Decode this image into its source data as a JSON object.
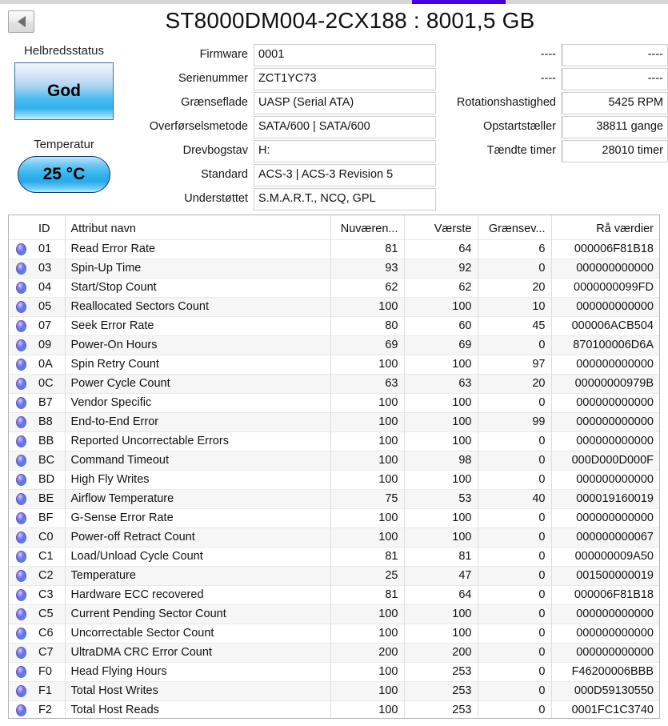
{
  "window": {
    "title": "ST8000DM004-2CX188 : 8001,5 GB",
    "back_button_label": "",
    "accent_color": "#4400e0"
  },
  "health": {
    "caption": "Helbredsstatus",
    "status": "God",
    "temp_caption": "Temperatur",
    "temperature": "25 °C"
  },
  "info_left": [
    {
      "label": "Firmware",
      "value": "0001"
    },
    {
      "label": "Serienummer",
      "value": "ZCT1YC73"
    },
    {
      "label": "Grænseflade",
      "value": "UASP (Serial ATA)"
    },
    {
      "label": "Overførselsmetode",
      "value": "SATA/600 | SATA/600"
    },
    {
      "label": "Drevbogstav",
      "value": "H:"
    },
    {
      "label": "Standard",
      "value": "ACS-3 | ACS-3 Revision 5"
    },
    {
      "label": "Understøttet",
      "value": "S.M.A.R.T., NCQ, GPL"
    }
  ],
  "info_right": [
    {
      "label": "----",
      "value": "----"
    },
    {
      "label": "----",
      "value": "----"
    },
    {
      "label": "Rotationshastighed",
      "value": "5425 RPM"
    },
    {
      "label": "Opstartstæller",
      "value": "38811 gange"
    },
    {
      "label": "Tændte timer",
      "value": "28010 timer"
    }
  ],
  "table": {
    "headers": {
      "icon": "",
      "id": "ID",
      "name": "Attribut navn",
      "current": "Nuværen...",
      "worst": "Værste",
      "threshold": "Grænsev...",
      "raw": "Rå værdier"
    },
    "rows": [
      {
        "icon": "status-dot-good",
        "id": "01",
        "name": "Read Error Rate",
        "current": "81",
        "worst": "64",
        "threshold": "6",
        "raw": "000006F81B18"
      },
      {
        "icon": "status-dot-good",
        "id": "03",
        "name": "Spin-Up Time",
        "current": "93",
        "worst": "92",
        "threshold": "0",
        "raw": "000000000000"
      },
      {
        "icon": "status-dot-good",
        "id": "04",
        "name": "Start/Stop Count",
        "current": "62",
        "worst": "62",
        "threshold": "20",
        "raw": "0000000099FD"
      },
      {
        "icon": "status-dot-good",
        "id": "05",
        "name": "Reallocated Sectors Count",
        "current": "100",
        "worst": "100",
        "threshold": "10",
        "raw": "000000000000"
      },
      {
        "icon": "status-dot-good",
        "id": "07",
        "name": "Seek Error Rate",
        "current": "80",
        "worst": "60",
        "threshold": "45",
        "raw": "000006ACB504"
      },
      {
        "icon": "status-dot-good",
        "id": "09",
        "name": "Power-On Hours",
        "current": "69",
        "worst": "69",
        "threshold": "0",
        "raw": "870100006D6A"
      },
      {
        "icon": "status-dot-good",
        "id": "0A",
        "name": "Spin Retry Count",
        "current": "100",
        "worst": "100",
        "threshold": "97",
        "raw": "000000000000"
      },
      {
        "icon": "status-dot-good",
        "id": "0C",
        "name": "Power Cycle Count",
        "current": "63",
        "worst": "63",
        "threshold": "20",
        "raw": "00000000979B"
      },
      {
        "icon": "status-dot-good",
        "id": "B7",
        "name": "Vendor Specific",
        "current": "100",
        "worst": "100",
        "threshold": "0",
        "raw": "000000000000"
      },
      {
        "icon": "status-dot-good",
        "id": "B8",
        "name": "End-to-End Error",
        "current": "100",
        "worst": "100",
        "threshold": "99",
        "raw": "000000000000"
      },
      {
        "icon": "status-dot-good",
        "id": "BB",
        "name": "Reported Uncorrectable Errors",
        "current": "100",
        "worst": "100",
        "threshold": "0",
        "raw": "000000000000"
      },
      {
        "icon": "status-dot-good",
        "id": "BC",
        "name": "Command Timeout",
        "current": "100",
        "worst": "98",
        "threshold": "0",
        "raw": "000D000D000F"
      },
      {
        "icon": "status-dot-good",
        "id": "BD",
        "name": "High Fly Writes",
        "current": "100",
        "worst": "100",
        "threshold": "0",
        "raw": "000000000000"
      },
      {
        "icon": "status-dot-good",
        "id": "BE",
        "name": "Airflow Temperature",
        "current": "75",
        "worst": "53",
        "threshold": "40",
        "raw": "000019160019"
      },
      {
        "icon": "status-dot-good",
        "id": "BF",
        "name": "G-Sense Error Rate",
        "current": "100",
        "worst": "100",
        "threshold": "0",
        "raw": "000000000000"
      },
      {
        "icon": "status-dot-good",
        "id": "C0",
        "name": "Power-off Retract Count",
        "current": "100",
        "worst": "100",
        "threshold": "0",
        "raw": "000000000067"
      },
      {
        "icon": "status-dot-good",
        "id": "C1",
        "name": "Load/Unload Cycle Count",
        "current": "81",
        "worst": "81",
        "threshold": "0",
        "raw": "000000009A50"
      },
      {
        "icon": "status-dot-good",
        "id": "C2",
        "name": "Temperature",
        "current": "25",
        "worst": "47",
        "threshold": "0",
        "raw": "001500000019"
      },
      {
        "icon": "status-dot-good",
        "id": "C3",
        "name": "Hardware ECC recovered",
        "current": "81",
        "worst": "64",
        "threshold": "0",
        "raw": "000006F81B18"
      },
      {
        "icon": "status-dot-good",
        "id": "C5",
        "name": "Current Pending Sector Count",
        "current": "100",
        "worst": "100",
        "threshold": "0",
        "raw": "000000000000"
      },
      {
        "icon": "status-dot-good",
        "id": "C6",
        "name": "Uncorrectable Sector Count",
        "current": "100",
        "worst": "100",
        "threshold": "0",
        "raw": "000000000000"
      },
      {
        "icon": "status-dot-good",
        "id": "C7",
        "name": "UltraDMA CRC Error Count",
        "current": "200",
        "worst": "200",
        "threshold": "0",
        "raw": "000000000000"
      },
      {
        "icon": "status-dot-good",
        "id": "F0",
        "name": "Head Flying Hours",
        "current": "100",
        "worst": "253",
        "threshold": "0",
        "raw": "F46200006BBB"
      },
      {
        "icon": "status-dot-good",
        "id": "F1",
        "name": "Total Host Writes",
        "current": "100",
        "worst": "253",
        "threshold": "0",
        "raw": "000D59130550"
      },
      {
        "icon": "status-dot-good",
        "id": "F2",
        "name": "Total Host Reads",
        "current": "100",
        "worst": "253",
        "threshold": "0",
        "raw": "0001FC1C3740"
      }
    ]
  }
}
